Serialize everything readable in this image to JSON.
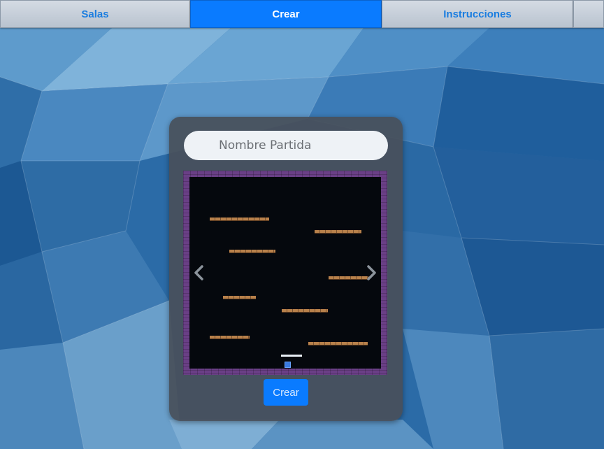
{
  "nav": {
    "tabs": [
      {
        "label": "Salas",
        "active": false
      },
      {
        "label": "Crear",
        "active": true
      },
      {
        "label": "Instrucciones",
        "active": false
      },
      {
        "label": "",
        "active": false
      }
    ]
  },
  "form": {
    "name_placeholder": "Nombre Partida",
    "name_value": "",
    "create_label": "Crear"
  },
  "map_preview": {
    "prev_icon": "chevron-left-icon",
    "next_icon": "chevron-right-icon",
    "wall_color": "#6a3f86",
    "floor_color": "#05080d",
    "platform_color": "#b8814b",
    "player_color": "#3a7be0"
  },
  "colors": {
    "accent": "#0a7bff",
    "panel": "#48505a",
    "background": "#2a6aa6"
  }
}
